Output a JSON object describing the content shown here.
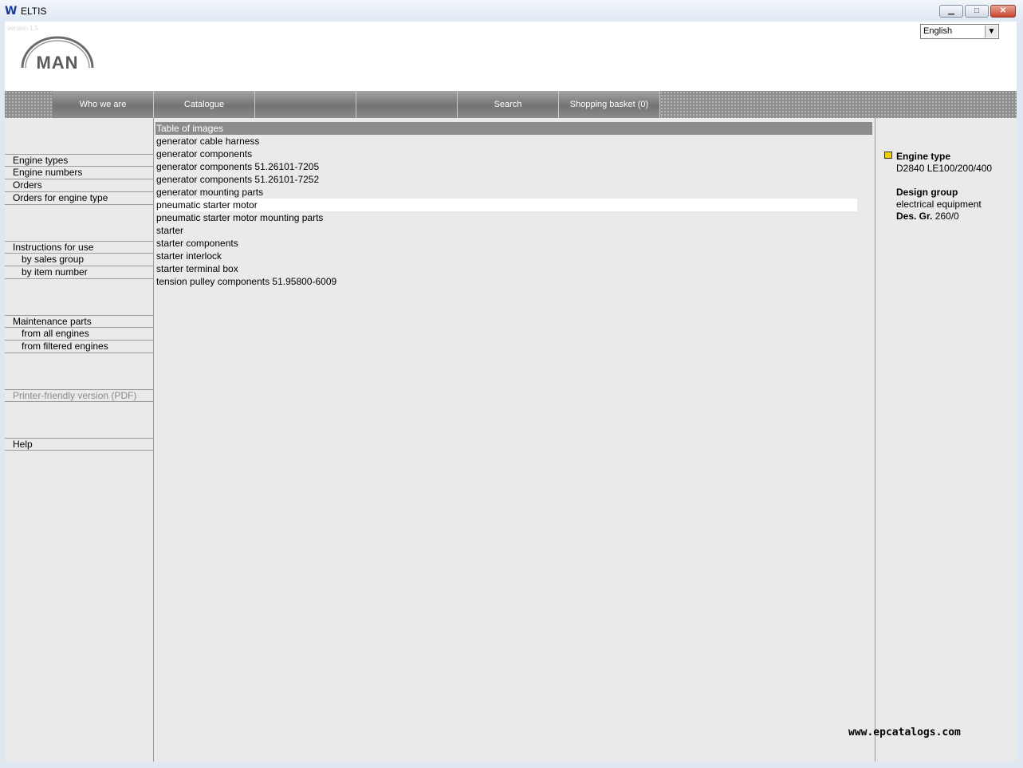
{
  "window": {
    "title": "ELTIS"
  },
  "header": {
    "version": "version 1.5",
    "brand": "MAN",
    "language": {
      "selected": "English"
    }
  },
  "nav": {
    "items": [
      "Who we are",
      "Catalogue",
      "",
      "",
      "Search",
      "Shopping basket (0)"
    ]
  },
  "sidebar": {
    "engine_types": "Engine types",
    "engine_numbers": "Engine numbers",
    "orders": "Orders",
    "orders_engine_type": "Orders for engine type",
    "instructions": "Instructions for use",
    "by_sales_group": "by sales group",
    "by_item_number": "by item number",
    "maintenance": "Maintenance parts",
    "from_all": "from all engines",
    "from_filtered": "from filtered engines",
    "printer": "Printer-friendly version (PDF)",
    "help": "Help"
  },
  "list": {
    "header": "Table of images",
    "items": [
      "generator cable harness",
      "generator components",
      "generator components 51.26101-7205",
      "generator components 51.26101-7252",
      "generator mounting parts",
      "pneumatic starter motor",
      "pneumatic starter motor mounting parts",
      "starter",
      "starter components",
      "starter interlock",
      "starter terminal box",
      "tension pulley components 51.95800-6009"
    ],
    "selected_index": 5
  },
  "info": {
    "engine_type_label": "Engine type",
    "engine_type_value": "D2840 LE100/200/400",
    "design_group_label": "Design group",
    "design_group_value": "electrical equipment",
    "des_gr_label": "Des. Gr.",
    "des_gr_value": "260/0"
  },
  "watermark": "www.epcatalogs.com",
  "colors": {
    "nav_bg": "#7a7a7a",
    "list_header": "#8c8c8c",
    "panel_bg": "#eaeaea"
  }
}
